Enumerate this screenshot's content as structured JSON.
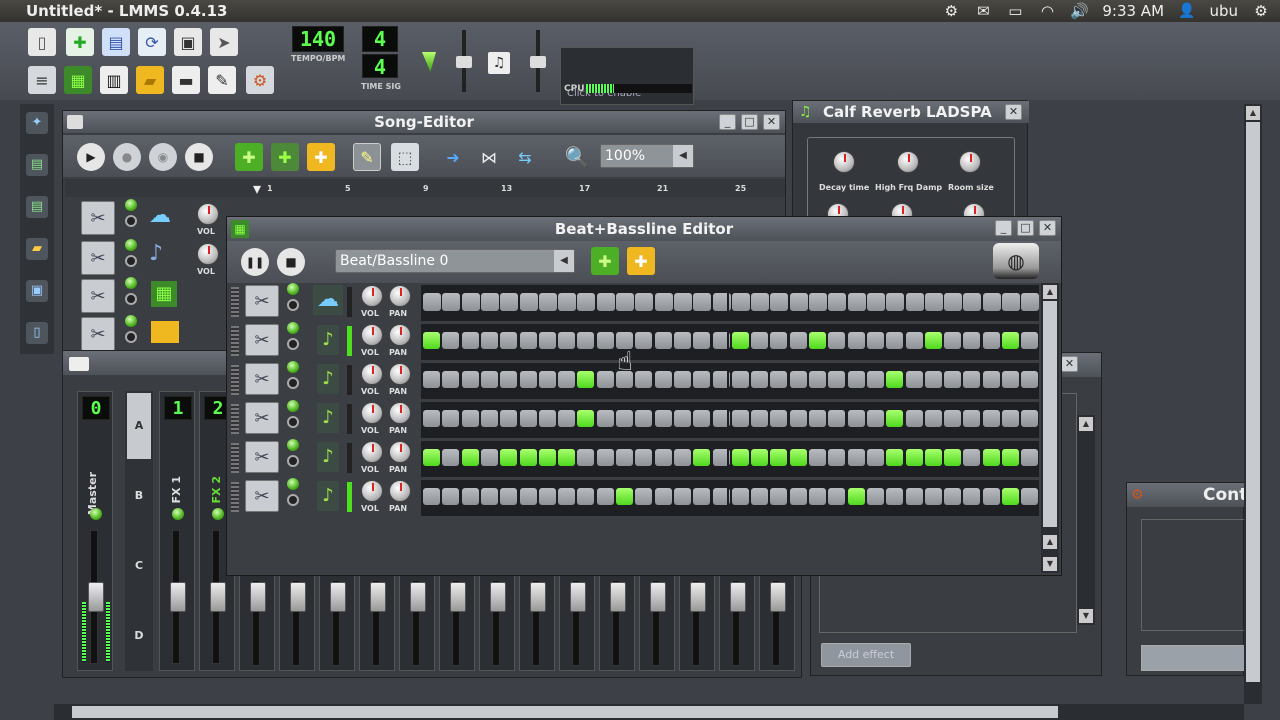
{
  "app": {
    "title": "Untitled* - LMMS 0.4.13"
  },
  "system": {
    "time": "9:33 AM",
    "user": "ubu"
  },
  "toolbar": {
    "tempo_value": "140",
    "tempo_label": "TEMPO/BPM",
    "timesig_num": "4",
    "timesig_den": "4",
    "timesig_label": "TIME SIG",
    "cpu_click": "Click to enable",
    "cpu_label": "CPU"
  },
  "song_editor": {
    "title": "Song-Editor",
    "zoom": "100%",
    "ruler": [
      "1",
      "5",
      "9",
      "13",
      "17",
      "21",
      "25"
    ],
    "vol_label": "VOL"
  },
  "calf": {
    "title": "Calf Reverb LADSPA",
    "knobs": [
      "Decay time",
      "High Frq Damp",
      "Room size"
    ]
  },
  "bb_editor": {
    "title": "Beat+Bassline Editor",
    "pattern": "Beat/Bassline 0",
    "vol_label": "VOL",
    "pan_label": "PAN",
    "rows": [
      {
        "on": []
      },
      {
        "on": [
          0,
          16,
          20,
          26,
          30
        ]
      },
      {
        "on": [
          8,
          24
        ]
      },
      {
        "on": [
          8,
          24
        ]
      },
      {
        "on": [
          0,
          2,
          4,
          5,
          6,
          7,
          14,
          16,
          17,
          18,
          19,
          24,
          25,
          26,
          27,
          29,
          30
        ]
      },
      {
        "on": [
          10,
          22,
          30
        ]
      }
    ]
  },
  "mixer": {
    "channels": [
      {
        "lcd": "0",
        "name": "Master"
      },
      {
        "lcd": "1",
        "name": "FX 1"
      },
      {
        "lcd": "2",
        "name": "FX 2"
      }
    ],
    "tabs": [
      "A",
      "B",
      "C",
      "D"
    ]
  },
  "fx_window": {
    "add_effect": "Add effect"
  },
  "controller": {
    "title": "Cont"
  }
}
